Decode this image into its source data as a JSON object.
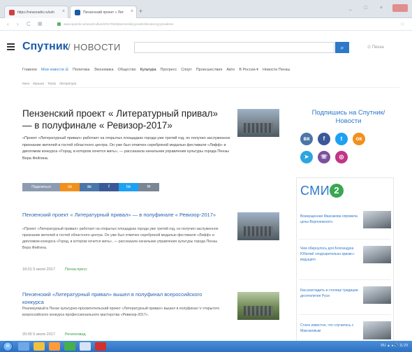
{
  "browser": {
    "tabs": [
      {
        "label": "https://newsradio.ru/ssh",
        "active": false
      },
      {
        "label": "Пензенский проект « Лит",
        "active": true
      }
    ],
    "new_tab": "+",
    "url": "www.sputnik.ru/news/culture/20170526/penzenskij-proekt-literaturnyj-privalenie",
    "window_buttons": "_ □ ×"
  },
  "header": {
    "brand": "Спутник",
    "section": "/ НОВОСТИ",
    "search_placeholder": "",
    "search_icon": "search-icon",
    "geo": "Пенза"
  },
  "menu": {
    "items": [
      {
        "label": "Главное",
        "style": "normal"
      },
      {
        "label": "Мои новости ☰",
        "style": "blue"
      },
      {
        "label": "Политика",
        "style": "normal"
      },
      {
        "label": "Экономика",
        "style": "normal"
      },
      {
        "label": "Общество",
        "style": "normal"
      },
      {
        "label": "Культура",
        "style": "sel"
      },
      {
        "label": "Прогресс",
        "style": "normal"
      },
      {
        "label": "Спорт",
        "style": "normal"
      },
      {
        "label": "Происшествия",
        "style": "normal"
      },
      {
        "label": "Авто",
        "style": "normal"
      },
      {
        "label": "В России ▾",
        "style": "normal"
      },
      {
        "label": "Новости Пензы",
        "style": "normal"
      }
    ]
  },
  "breadcrumbs": [
    "Кино",
    "Музыка",
    "Театр",
    "Литература"
  ],
  "article": {
    "title": "Пензенский проект « Литературный привал» — в полуфинале « Ревизор-2017»",
    "lead": "«Проект «Литературный привал» работает на открытых площадках города уже третий год, он получил заслуженное признание жителей и гостей областного центра. Он уже был отмечен серебряной медалью фестиваля «Лифф» и дипломом конкурса «Город, в котором хочется жить», — рассказала начальник управления культуры города Пензы Вера Фейгина.",
    "share": {
      "count": "Поделиться",
      "buttons": [
        "ок",
        "вк",
        "f",
        "tw",
        "✉"
      ]
    }
  },
  "news": [
    {
      "title": "Пензенский проект « Литературный привал» — в полуфинале « Ревизор-2017»",
      "text": "«Проект «Литературный привал» работает на открытых площадках города уже третий год, он получил заслуженное признание жителей и гостей областного центра. Он уже был отмечен серебряной медалью фестиваля «Лифф» и дипломом конкурса «Город, в котором хочется жить», — рассказала начальник управления культуры города Пензы Вера Фейгина.",
      "date": "18:01 5 июля 2017",
      "source": "Пенза-пресс"
    },
    {
      "title": "Пензенский «Литературный привал» вышел в полуфинал всероссийского конкурса",
      "text": "Реализуемый в Пензе культурно-просветительский проект «Литературный привал» вышел в полуфинал Ⅴ открытого всероссийского конкурса профессионального мастерства «Ревизор-2017».",
      "date": "20:05 5 июля 2017",
      "source": "Регионовед"
    }
  ],
  "sidebar": {
    "subscribe_title": "Подпишись на Спутник/Новости",
    "social": [
      {
        "name": "vk-icon",
        "label": "вк",
        "color": "#4a76a8"
      },
      {
        "name": "facebook-icon",
        "label": "f",
        "color": "#3b5998"
      },
      {
        "name": "twitter-icon",
        "label": "t",
        "color": "#1da1f2"
      },
      {
        "name": "odnoklassniki-icon",
        "label": "ок",
        "color": "#f2901c"
      },
      {
        "name": "telegram-icon",
        "label": "➤",
        "color": "#2ca5e0"
      },
      {
        "name": "viber-icon",
        "label": "☏",
        "color": "#7b519d"
      },
      {
        "name": "instagram-icon",
        "label": "◎",
        "color": "#c13584"
      }
    ],
    "smi_logo": "СМИ",
    "smi_number": "2",
    "smi_items": [
      "Возмущенная Максакова опровела цены Воронежского.",
      "Чем обернулось для Блогиндука Юбилей «подозрительно кризис» ведущего",
      "Как разгладить в столице традиции десятилетия Руси",
      "Стало известно, что случилось с Максаковым"
    ]
  },
  "taskbar": {
    "start": "⊞",
    "tray": "RU ▲ ◂ 🔊 11:29"
  },
  "colors": {
    "accent": "#2c78c9",
    "brand": "#1a5aa6",
    "green": "#3aa652"
  }
}
